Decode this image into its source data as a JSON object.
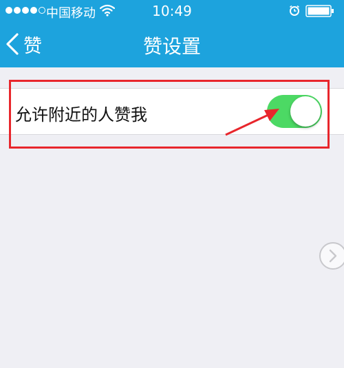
{
  "status_bar": {
    "carrier": "中国移动",
    "time": "10:49",
    "signal_bars_filled": 4,
    "signal_bars_total": 5
  },
  "nav": {
    "back_label": "赞",
    "title": "赞设置"
  },
  "settings": [
    {
      "label": "允许附近的人赞我",
      "enabled": true
    }
  ],
  "colors": {
    "header": "#1da3dd",
    "toggle_on": "#4cd964",
    "highlight": "#e8262c",
    "background": "#efeff4"
  }
}
